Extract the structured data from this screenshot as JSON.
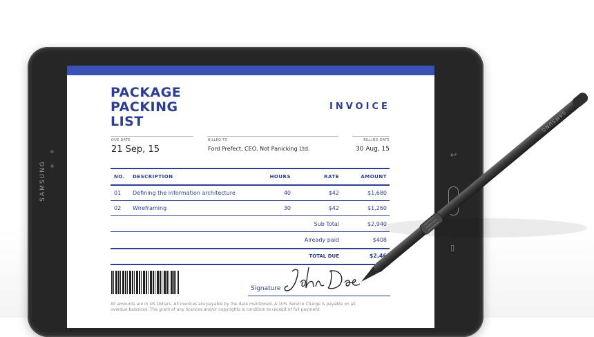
{
  "device": {
    "brand": "SAMSUNG",
    "pen_brand": "SAMSUNG"
  },
  "document": {
    "title_lines": [
      "PACKAGE",
      "PACKING",
      "LIST"
    ],
    "label": "INVOICE",
    "due_date": {
      "label": "DUE DATE",
      "value": "21 Sep, 15"
    },
    "billed_to": {
      "label": "BILLED TO",
      "value": "Ford Prefect, CEO, Not Panicking Ltd."
    },
    "billing_date": {
      "label": "BILLING DATE",
      "value": "30 Aug, 15"
    },
    "table": {
      "headers": {
        "no": "NO.",
        "description": "DESCRIPTION",
        "hours": "HOURS",
        "rate": "RATE",
        "amount": "AMOUNT"
      },
      "rows": [
        {
          "no": "01",
          "description": "Defining the information architecture",
          "hours": "40",
          "rate": "$42",
          "amount": "$1,680"
        },
        {
          "no": "02",
          "description": "Wireframing",
          "hours": "30",
          "rate": "$42",
          "amount": "$1,260"
        }
      ],
      "sub_total": {
        "label": "Sub Total",
        "value": "$2,940"
      },
      "already_paid": {
        "label": "Already paid",
        "value": "$408"
      },
      "total_due": {
        "label": "TOTAL DUE",
        "value": "$2,46"
      }
    },
    "signature": {
      "label": "Signature",
      "value": "John Doe"
    },
    "footer_lines": [
      "All amounts are in US Dollars. All invoices are payable by the date mentioned. A 10% Service Charge is payable on all",
      "overdue balances. The grant of any licences and/or copyrights is condition to receipt of full payment."
    ]
  },
  "colors": {
    "accent": "#2c3e8f",
    "top_bar": "#3a52b5",
    "bezel": "#262626"
  }
}
